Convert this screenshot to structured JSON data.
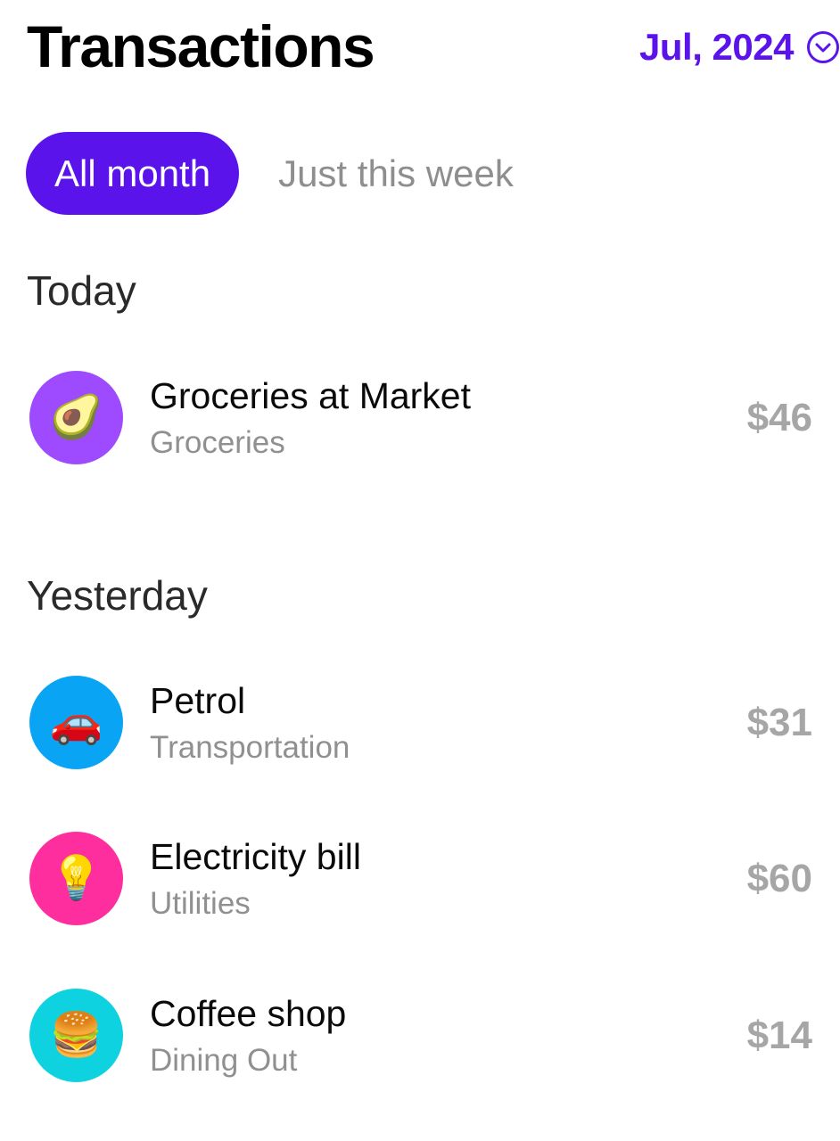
{
  "header": {
    "title": "Transactions",
    "month": "Jul, 2024",
    "month_icon": "chevron-down-circle-icon",
    "accent_color": "#5b13ec"
  },
  "filters": {
    "active": "All month",
    "inactive": "Just this week"
  },
  "sections": [
    {
      "label": "Today",
      "items": [
        {
          "name": "Groceries at Market",
          "category": "Groceries",
          "amount": "$46",
          "emoji": "🥑",
          "icon": "avocado-icon",
          "color": "#9e4bff"
        }
      ]
    },
    {
      "label": "Yesterday",
      "items": [
        {
          "name": "Petrol",
          "category": "Transportation",
          "amount": "$31",
          "emoji": "🚗",
          "icon": "car-icon",
          "color": "#0aa4f5"
        },
        {
          "name": "Electricity bill",
          "category": "Utilities",
          "amount": "$60",
          "emoji": "💡",
          "icon": "light-bulb-icon",
          "color": "#ff2e9e"
        },
        {
          "name": "Coffee shop",
          "category": "Dining Out",
          "amount": "$14",
          "emoji": "🍔",
          "icon": "burger-icon",
          "color": "#0fd2e0"
        }
      ]
    }
  ]
}
